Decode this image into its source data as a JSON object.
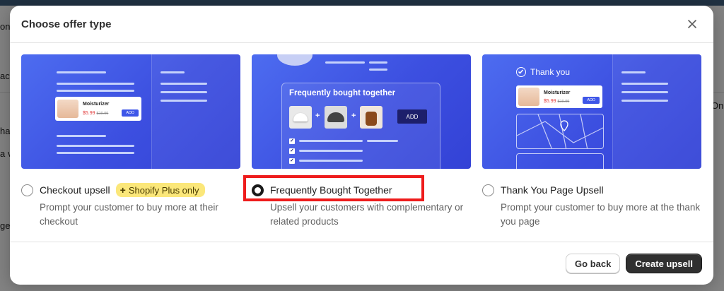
{
  "background": {
    "fragments": [
      "on",
      "act",
      "ha",
      "a v",
      "get",
      "On"
    ]
  },
  "modal": {
    "title": "Choose offer type",
    "close_icon": "close-icon",
    "options": [
      {
        "label": "Checkout upsell",
        "badge": "Shopify Plus only",
        "badge_icon": "plus-icon",
        "description": "Prompt your customer to buy more at their checkout",
        "selected": false
      },
      {
        "label": "Frequently Bought Together",
        "description": "Upsell your customers with complementary or related products",
        "selected": true
      },
      {
        "label": "Thank You Page Upsell",
        "description": "Prompt your customer to buy more at the thank you page",
        "selected": false
      }
    ],
    "illustrations": {
      "checkout": {
        "product_name": "Moisturizer",
        "price": "$5.99",
        "old_price": "$10.99",
        "add": "ADD"
      },
      "fbt": {
        "title": "Frequently bought together",
        "plus": "+",
        "add": "ADD"
      },
      "thank_you": {
        "title": "Thank you",
        "product_name": "Moisturizer",
        "price": "$5.99",
        "old_price": "$10.99",
        "add": "ADD"
      }
    },
    "footer": {
      "back_label": "Go back",
      "create_label": "Create upsell"
    }
  },
  "colors": {
    "illustration_blue": "#3c4fe0",
    "badge_yellow": "#fbe77a",
    "highlight_red": "#ee1c1c",
    "primary_button": "#303030"
  }
}
